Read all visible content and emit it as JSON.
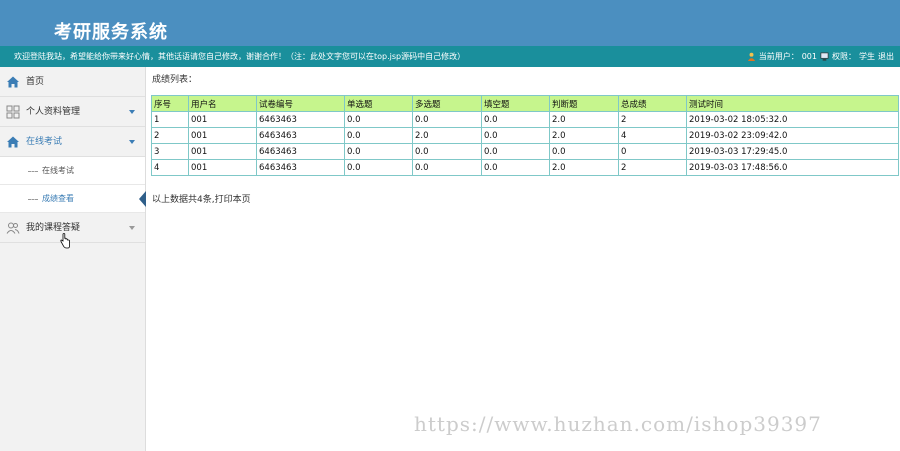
{
  "header": {
    "title": "考研服务系统"
  },
  "infobar": {
    "welcome": "欢迎登陆我站，希望能给你带来好心情，其他话语请您自己修改，谢谢合作！（注：此处文字您可以在top.jsp源码中自己修改）",
    "current_user_label": "当前用户：",
    "current_user": "001",
    "permission_label": "权限：",
    "permission": "学生",
    "logout": "退出"
  },
  "sidebar": {
    "items": [
      {
        "label": "首页",
        "icon": "home-icon"
      },
      {
        "label": "个人资料管理",
        "icon": "grid-icon"
      },
      {
        "label": "在线考试",
        "icon": "home-icon"
      },
      {
        "label": "我的课程答疑",
        "icon": "users-icon"
      }
    ],
    "sub_items": [
      {
        "label": "在线考试"
      },
      {
        "label": "成绩查看"
      }
    ]
  },
  "main": {
    "list_title": "成绩列表：",
    "columns": [
      "序号",
      "用户名",
      "试卷编号",
      "单选题",
      "多选题",
      "填空题",
      "判断题",
      "总成绩",
      "测试时间"
    ],
    "rows": [
      [
        "1",
        "001",
        "6463463",
        "0.0",
        "0.0",
        "0.0",
        "2.0",
        "2",
        "2019-03-02 18:05:32.0"
      ],
      [
        "2",
        "001",
        "6463463",
        "0.0",
        "2.0",
        "0.0",
        "2.0",
        "4",
        "2019-03-02 23:09:42.0"
      ],
      [
        "3",
        "001",
        "6463463",
        "0.0",
        "0.0",
        "0.0",
        "0.0",
        "0",
        "2019-03-03 17:29:45.0"
      ],
      [
        "4",
        "001",
        "6463463",
        "0.0",
        "0.0",
        "0.0",
        "2.0",
        "2",
        "2019-03-03 17:48:56.0"
      ]
    ],
    "summary": "以上数据共4条,打印本页"
  },
  "watermark": "https://www.huzhan.com/ishop39397",
  "colors": {
    "header_bg": "#4b8fc0",
    "infobar_bg": "#1a8f9c",
    "table_header_bg": "#c6f58d",
    "table_border": "#7fc8c8",
    "accent": "#3b7db5"
  }
}
